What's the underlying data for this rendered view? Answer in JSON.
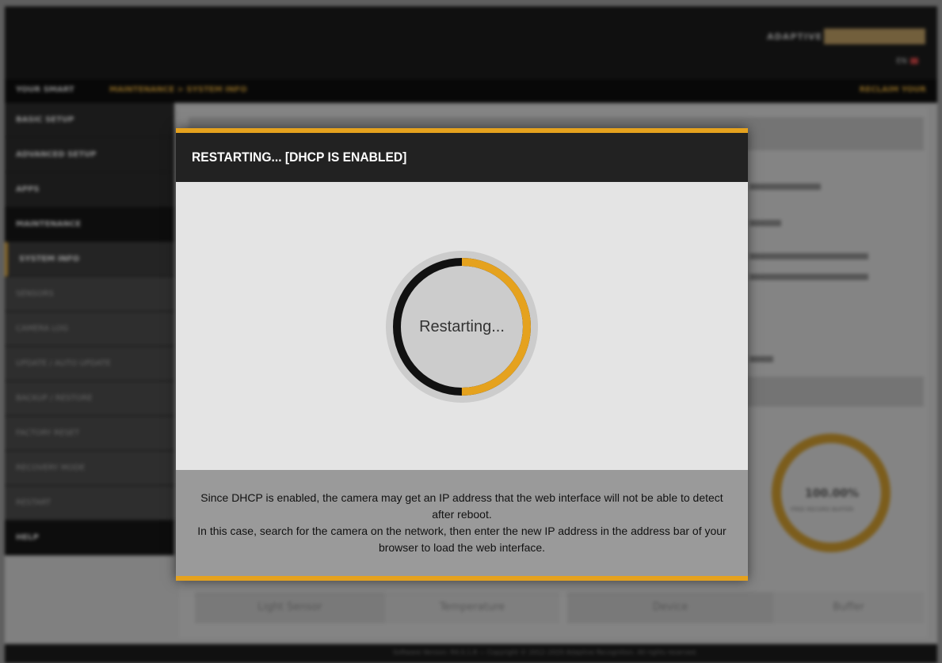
{
  "background": {
    "brand_text": "ADAPTIVE",
    "lang": "EN",
    "breadcrumb": {
      "home": "YOUR SMART",
      "path": "MAINTENANCE > SYSTEM INFO",
      "right": "RECLAIM YOUR"
    },
    "sidebar_items": [
      "BASIC SETUP",
      "ADVANCED SETUP",
      "APPS",
      "MAINTENANCE",
      "SYSTEM INFO",
      "SENSORS",
      "CAMERA LOG",
      "UPDATE / AUTO UPDATE",
      "BACKUP / RESTORE",
      "FACTORY RESET",
      "RECOVERY MODE",
      "RESTART",
      "HELP"
    ],
    "gauge_value": "100.00%",
    "gauge_caption": "FREE RECORD BUFFER",
    "bottom_tabs": [
      "Light Sensor",
      "Temperature",
      "Device",
      "Buffer"
    ],
    "footer": "Software Version: R4.0.1.8 — Copyright © 2012–2020 Adaptive Recognition. All rights reserved."
  },
  "modal": {
    "title": "RESTARTING... [DHCP IS ENABLED]",
    "spinner_label": "Restarting...",
    "spinner_progress": 0.5,
    "colors": {
      "accent": "#e5a21e",
      "header_bg": "#222222",
      "spinner_track": "#111111",
      "spinner_ring_bg": "#cccccc"
    },
    "message": [
      "Since DHCP is enabled, the camera may get an IP address that the web interface will not be able to detect after reboot.",
      "In this case, search for the camera on the network, then enter the new IP address in the address bar of your browser to load the web interface."
    ]
  }
}
